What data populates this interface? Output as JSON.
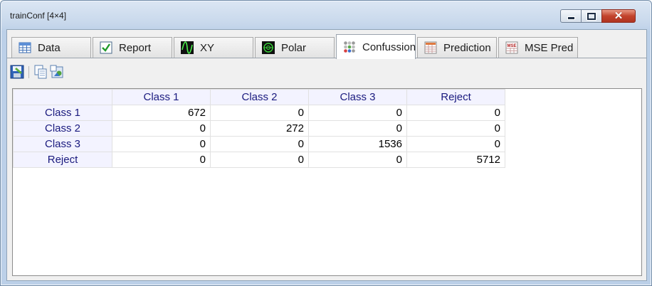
{
  "window": {
    "title": "trainConf [4×4]",
    "close_glyph": "✕"
  },
  "tabs": [
    {
      "label": "Data",
      "icon": "table-icon"
    },
    {
      "label": "Report",
      "icon": "checkmark-icon"
    },
    {
      "label": "XY",
      "icon": "waveform-icon"
    },
    {
      "label": "Polar",
      "icon": "polar-plot-icon"
    },
    {
      "label": "Confussion",
      "icon": "dots-grid-icon",
      "active": true
    },
    {
      "label": "Prediction",
      "icon": "grid-table-icon"
    },
    {
      "label": "MSE Pred",
      "icon": "mse-icon",
      "icon_text": "MSE"
    }
  ],
  "toolbar": {
    "save_icon": "save-icon",
    "copy_icon": "copy-icon",
    "export_icon": "export-image-icon"
  },
  "grid": {
    "columns": [
      "Class 1",
      "Class 2",
      "Class 3",
      "Reject"
    ],
    "rows": [
      {
        "label": "Class 1",
        "values": [
          "672",
          "0",
          "0",
          "0"
        ]
      },
      {
        "label": "Class 2",
        "values": [
          "0",
          "272",
          "0",
          "0"
        ]
      },
      {
        "label": "Class 3",
        "values": [
          "0",
          "0",
          "1536",
          "0"
        ]
      },
      {
        "label": "Reject",
        "values": [
          "0",
          "0",
          "0",
          "5712"
        ]
      }
    ]
  },
  "colors": {
    "header_text": "#1a1a7e",
    "header_bg": "#f3f3ff",
    "close_red": "#c2432c"
  }
}
